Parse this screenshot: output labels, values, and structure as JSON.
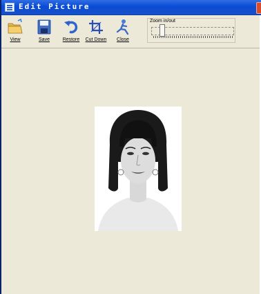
{
  "window": {
    "title": "Edit Picture"
  },
  "toolbar": {
    "buttons": [
      {
        "label": "View",
        "icon": "folder-open-icon"
      },
      {
        "label": "Save",
        "icon": "floppy-disk-icon"
      },
      {
        "label": "Restore",
        "icon": "undo-arrow-icon"
      },
      {
        "label": "Cut Down",
        "icon": "crop-icon"
      },
      {
        "label": "Close",
        "icon": "exit-figure-icon"
      }
    ]
  },
  "zoom": {
    "label": "Zoom in/out",
    "value_fraction": 0.1
  },
  "colors": {
    "title_bar": "#0a4bd6",
    "background": "#ece9d8",
    "accent_blue": "#2a5fd8"
  },
  "photo": {
    "description_icon": "portrait-photo"
  }
}
